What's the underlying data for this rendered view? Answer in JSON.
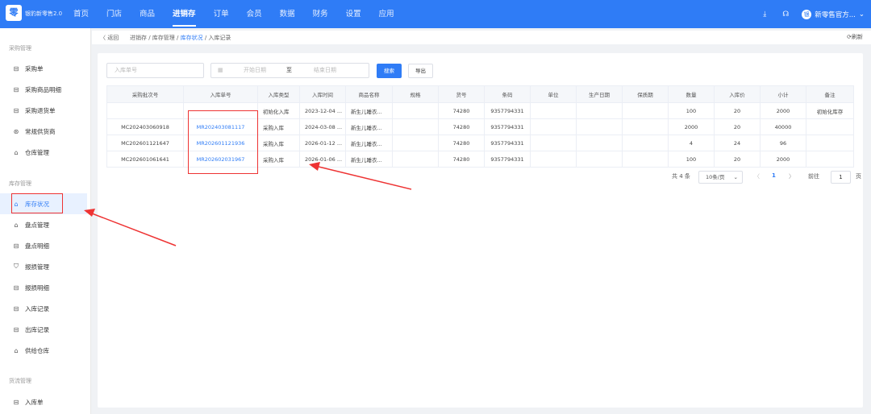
{
  "app": {
    "logo_glyph": "零",
    "brand": "银豹新零售2.0"
  },
  "nav": [
    "首页",
    "门店",
    "商品",
    "进销存",
    "订单",
    "会员",
    "数据",
    "财务",
    "设置",
    "应用"
  ],
  "nav_active_index": 3,
  "top_right": {
    "download_icon": "⤓",
    "headset_icon": "☊",
    "avatar_glyph": "银",
    "user": "新零售官方...",
    "chevron": "⌄"
  },
  "sidebar": {
    "group1": "采购管理",
    "group2": "库存管理",
    "group3": "货流管理",
    "items": [
      {
        "label": "采购单",
        "icon": "⊟"
      },
      {
        "label": "采购商品明细",
        "icon": "⊟"
      },
      {
        "label": "采购退货单",
        "icon": "⊟"
      },
      {
        "label": "常规供货商",
        "icon": "⊛"
      },
      {
        "label": "仓库管理",
        "icon": "⌂"
      },
      {
        "label": "库存状况",
        "icon": "⌂"
      },
      {
        "label": "盘点管理",
        "icon": "⌂"
      },
      {
        "label": "盘点明细",
        "icon": "⊟"
      },
      {
        "label": "报损管理",
        "icon": "⛉"
      },
      {
        "label": "报损明细",
        "icon": "⊟"
      },
      {
        "label": "入库记录",
        "icon": "⊟"
      },
      {
        "label": "出库记录",
        "icon": "⊟"
      },
      {
        "label": "供给仓库",
        "icon": "⌂"
      },
      {
        "label": "入库单",
        "icon": "⊟"
      }
    ]
  },
  "breadcrumb": {
    "back": "〈 返回",
    "path_prefix": "进销存 / 库存管理 / ",
    "current": "库存状况",
    "path_suffix": " / 入库记录",
    "refresh": "⟳刷新"
  },
  "filters": {
    "order_placeholder": "入库单号",
    "calendar_icon": "▦",
    "start_placeholder": "开始日期",
    "separator": "至",
    "end_placeholder": "结束日期",
    "search_label": "搜索",
    "export_label": "导出"
  },
  "table": {
    "headers": [
      "采购批次号",
      "入库单号",
      "入库类型",
      "入库时间",
      "商品名称",
      "规格",
      "货号",
      "条码",
      "单位",
      "生产日期",
      "保质期",
      "数量",
      "入库价",
      "小计",
      "备注"
    ],
    "rows": [
      [
        "",
        "",
        "初始化入库",
        "2023-12-04 ...",
        "新生儿睡衣...",
        "",
        "74280",
        "9357794331",
        "",
        "",
        "",
        "100",
        "20",
        "2000",
        "初始化库存"
      ],
      [
        "MC202403060918",
        "MR202403081117",
        "采购入库",
        "2024-03-08 ...",
        "新生儿睡衣...",
        "",
        "74280",
        "9357794331",
        "",
        "",
        "",
        "2000",
        "20",
        "40000",
        ""
      ],
      [
        "MC202601121647",
        "MR202601121936",
        "采购入库",
        "2026-01-12 ...",
        "新生儿睡衣...",
        "",
        "74280",
        "9357794331",
        "",
        "",
        "",
        "4",
        "24",
        "96",
        ""
      ],
      [
        "MC202601061641",
        "MR202602031967",
        "采购入库",
        "2026-01-06 ...",
        "新生儿睡衣...",
        "",
        "74280",
        "9357794331",
        "",
        "",
        "",
        "100",
        "20",
        "2000",
        ""
      ]
    ]
  },
  "pagination": {
    "total": "共 4 条",
    "page_size": "10条/页",
    "page_size_chevron": "⌄",
    "prev": "〈",
    "current": "1",
    "next": "〉",
    "goto_prefix": "前往",
    "goto_value": "1",
    "goto_suffix": "页"
  },
  "colors": {
    "primary": "#2f7cf6",
    "annotation": "#e33333"
  }
}
